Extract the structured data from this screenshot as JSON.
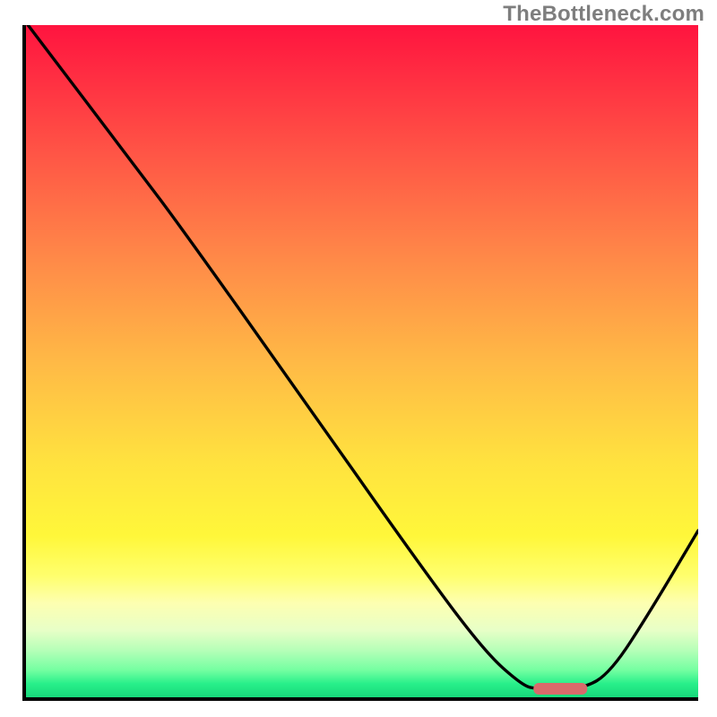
{
  "attribution": "TheBottleneck.com",
  "chart_data": {
    "type": "line",
    "title": "",
    "xlabel": "",
    "ylabel": "",
    "xlim": [
      0,
      1
    ],
    "ylim": [
      0,
      1
    ],
    "series": [
      {
        "name": "curve",
        "points": [
          {
            "x": 0.003,
            "y": 1.0
          },
          {
            "x": 0.17,
            "y": 0.78
          },
          {
            "x": 0.23,
            "y": 0.7
          },
          {
            "x": 0.408,
            "y": 0.45
          },
          {
            "x": 0.57,
            "y": 0.219
          },
          {
            "x": 0.68,
            "y": 0.07
          },
          {
            "x": 0.738,
            "y": 0.018
          },
          {
            "x": 0.76,
            "y": 0.012
          },
          {
            "x": 0.828,
            "y": 0.012
          },
          {
            "x": 0.87,
            "y": 0.037
          },
          {
            "x": 0.93,
            "y": 0.13
          },
          {
            "x": 1.0,
            "y": 0.248
          }
        ]
      }
    ],
    "marker": {
      "name": "optimum",
      "x_start": 0.755,
      "x_end": 0.835,
      "y": 0.012,
      "color": "#d96a6b"
    },
    "gradient_stops": [
      {
        "pos": 0.0,
        "color": "#ff143f"
      },
      {
        "pos": 0.08,
        "color": "#ff2f42"
      },
      {
        "pos": 0.2,
        "color": "#ff5846"
      },
      {
        "pos": 0.35,
        "color": "#ff8a48"
      },
      {
        "pos": 0.5,
        "color": "#ffb946"
      },
      {
        "pos": 0.65,
        "color": "#ffe23f"
      },
      {
        "pos": 0.76,
        "color": "#fff73a"
      },
      {
        "pos": 0.82,
        "color": "#ffff6e"
      },
      {
        "pos": 0.86,
        "color": "#fdffb1"
      },
      {
        "pos": 0.9,
        "color": "#e8ffc7"
      },
      {
        "pos": 0.93,
        "color": "#b6ffb8"
      },
      {
        "pos": 0.96,
        "color": "#73ffa1"
      },
      {
        "pos": 0.98,
        "color": "#28ef8a"
      },
      {
        "pos": 1.0,
        "color": "#17d87b"
      }
    ]
  }
}
